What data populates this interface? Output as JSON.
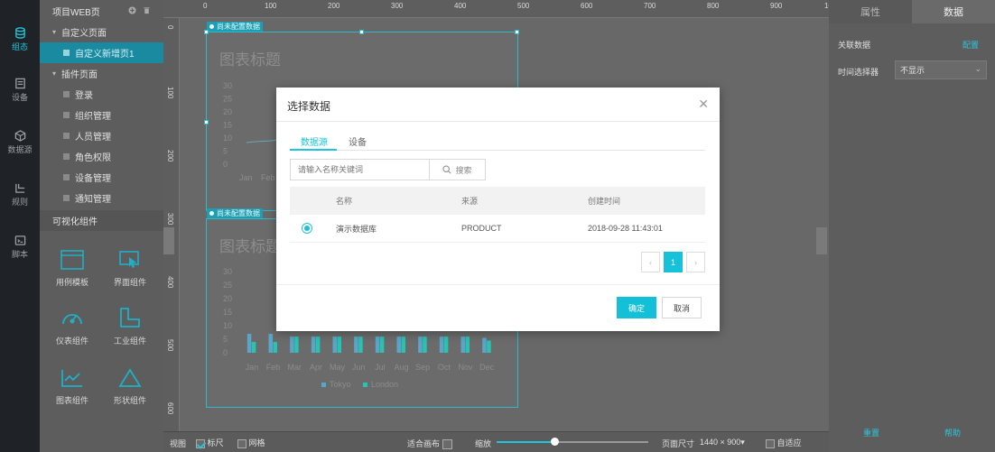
{
  "nav": [
    {
      "label": "组态",
      "icon": "database-icon",
      "active": true
    },
    {
      "label": "设备",
      "icon": "device-icon",
      "active": false
    },
    {
      "label": "数据源",
      "icon": "cube-icon",
      "active": false
    },
    {
      "label": "规则",
      "icon": "rule-icon",
      "active": false
    },
    {
      "label": "脚本",
      "icon": "script-icon",
      "active": false
    }
  ],
  "tree": {
    "project_title": "项目WEB页",
    "groups": [
      {
        "label": "自定义页面",
        "items": [
          "自定义新增页1"
        ]
      },
      {
        "label": "插件页面",
        "items": [
          "登录",
          "组织管理",
          "人员管理",
          "角色权限",
          "设备管理",
          "通知管理"
        ]
      }
    ],
    "components_title": "可视化组件",
    "components": [
      "用例模板",
      "界面组件",
      "仪表组件",
      "工业组件",
      "图表组件",
      "形状组件"
    ]
  },
  "canvas": {
    "ruler_top": [
      "0",
      "100",
      "200",
      "300",
      "400",
      "500",
      "600",
      "700",
      "800",
      "900",
      "10"
    ],
    "ruler_left": [
      "0",
      "100",
      "200",
      "300",
      "400",
      "500",
      "600"
    ],
    "chart_tag": "尚未配置数据",
    "chart_title": "图表标题",
    "chart2_title": "图表标题"
  },
  "chart_data": {
    "type": "bar",
    "title": "图表标题",
    "categories": [
      "Jan",
      "Feb",
      "Mar",
      "Apr",
      "May",
      "Jun",
      "Jul",
      "Aug",
      "Sep",
      "Oct",
      "Nov",
      "Dec"
    ],
    "series": [
      {
        "name": "Tokyo",
        "values": [
          7,
          7,
          6,
          6,
          6,
          6,
          6,
          6,
          6,
          6,
          6,
          5.5
        ],
        "color": "#5aa6c8"
      },
      {
        "name": "London",
        "values": [
          4,
          4,
          6,
          6,
          6,
          6,
          6,
          6,
          6,
          6,
          6,
          4.5
        ],
        "color": "#29c3b3"
      }
    ],
    "yticks": [
      "30",
      "25",
      "20",
      "15",
      "10",
      "5",
      "0"
    ],
    "ylim": [
      0,
      30
    ]
  },
  "line_chart": {
    "categories": [
      "Jan",
      "Feb"
    ],
    "yticks": [
      "30",
      "25",
      "20",
      "15",
      "10",
      "5",
      "0"
    ]
  },
  "bottombar": {
    "view_label": "视图",
    "ruler_label": "标尺",
    "grid_label": "网格",
    "fit_label": "适合画布",
    "zoom_label": "缩放",
    "zoom_level": 0.38,
    "page_size_label": "页面尺寸",
    "page_size_value": "1440 × 900▾",
    "adaptive_label": "自适应"
  },
  "rpanel": {
    "tab_props": "属性",
    "tab_data": "数据",
    "link_data_label": "关联数据",
    "config_link": "配置",
    "time_selector_label": "时间选择器",
    "time_selector_value": "不显示",
    "reset_label": "重置",
    "help_label": "帮助"
  },
  "modal": {
    "title": "选择数据",
    "tabs": [
      "数据源",
      "设备"
    ],
    "search_placeholder": "请输入名称关键词",
    "search_button": "搜索",
    "columns": [
      "名称",
      "来源",
      "创建时间"
    ],
    "rows": [
      {
        "name": "演示数据库",
        "source": "PRODUCT",
        "created": "2018-09-28 11:43:01"
      }
    ],
    "page": "1",
    "ok": "确定",
    "cancel": "取消"
  },
  "colors": {
    "accent": "#17c1da",
    "active_nav": "#21c7de"
  }
}
